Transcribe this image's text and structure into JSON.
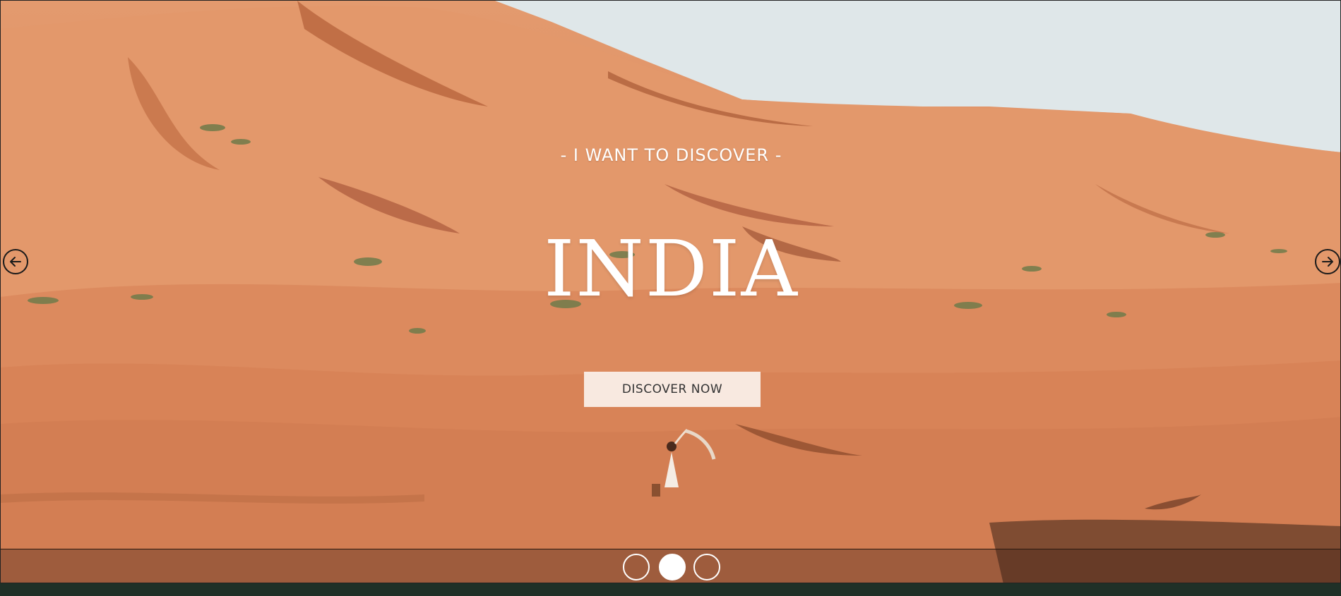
{
  "slider": {
    "eyebrow": "- I WANT TO DISCOVER -",
    "title": "INDIA",
    "cta_label": "DISCOVER NOW",
    "prev_icon": "arrow-left-circle-icon",
    "next_icon": "arrow-right-circle-icon",
    "slide_count": 3,
    "active_slide": 2
  },
  "colors": {
    "sand": "#e08f63",
    "sky": "#dde6e8",
    "text": "#ffffff",
    "footer": "#1f3027"
  }
}
